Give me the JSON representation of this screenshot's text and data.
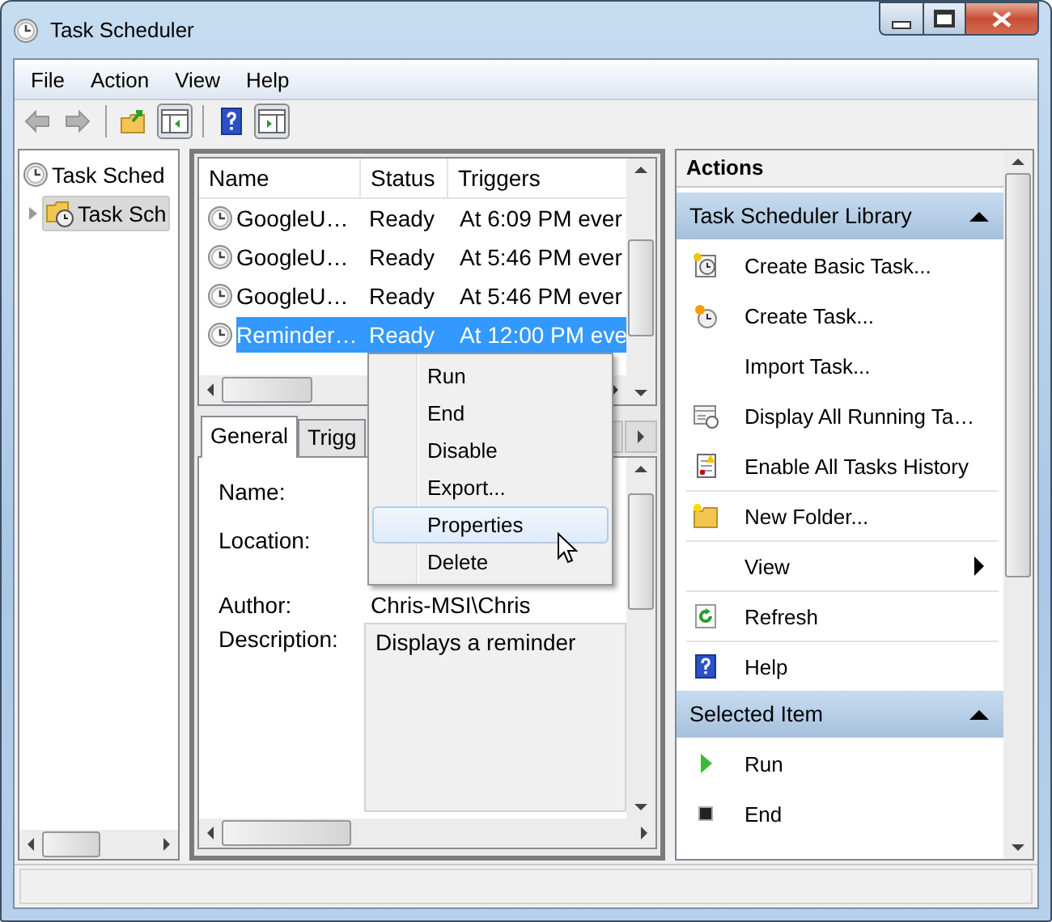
{
  "window": {
    "title": "Task Scheduler"
  },
  "menu": [
    "File",
    "Action",
    "View",
    "Help"
  ],
  "toolbar": [
    [
      {
        "disabled": true,
        "pressed": false
      },
      {
        "disabled": true,
        "pressed": false
      }
    ],
    [
      {
        "disabled": false,
        "pressed": false
      },
      {
        "disabled": false,
        "pressed": true
      }
    ],
    [
      {
        "disabled": false,
        "pressed": false
      },
      {
        "disabled": false,
        "pressed": true
      }
    ]
  ],
  "tree": [
    {
      "label": "Task Sched",
      "selected": false,
      "children": [
        {
          "label": "Task Sch",
          "expanded": false,
          "selected": true
        }
      ]
    }
  ],
  "task_list": {
    "columns": [
      "Name",
      "Status",
      "Triggers"
    ],
    "rows": [
      {
        "name": "GoogleU…",
        "status": "Ready",
        "triggers": "At 6:09 PM ever",
        "selected": false
      },
      {
        "name": "GoogleU…",
        "status": "Ready",
        "triggers": "At 5:46 PM ever",
        "selected": false
      },
      {
        "name": "GoogleU…",
        "status": "Ready",
        "triggers": "At 5:46 PM ever",
        "selected": false
      },
      {
        "name": "Reminder…",
        "status": "Ready",
        "triggers": "At 12:00 PM eve",
        "selected": true
      }
    ]
  },
  "details": {
    "tabs": [
      {
        "label": "General",
        "selected": true
      },
      {
        "label": "Trigg",
        "selected": false
      }
    ],
    "fields": [
      {
        "label": "Name:",
        "kind": "text"
      },
      {
        "label": "Location:",
        "kind": "text"
      },
      {
        "label": "Author:",
        "kind": "text",
        "value": "Chris-MSI\\Chris"
      },
      {
        "label": "Description:",
        "kind": "textarea",
        "value": "Displays a reminder"
      }
    ]
  },
  "actions": {
    "title": "Actions",
    "sections": [
      {
        "title": "Task Scheduler Library",
        "expanded": true,
        "items": [
          {
            "label": "Create Basic Task...",
            "divider": false,
            "submenu": false
          },
          {
            "label": "Create Task...",
            "divider": false,
            "submenu": false
          },
          {
            "label": "Import Task...",
            "divider": false,
            "submenu": false
          },
          {
            "label": "Display All Running Ta…",
            "divider": false,
            "submenu": false
          },
          {
            "label": "Enable All Tasks History",
            "divider": false,
            "submenu": false
          },
          {
            "label": "New Folder...",
            "divider": true,
            "submenu": false
          },
          {
            "label": "View",
            "divider": true,
            "submenu": true
          },
          {
            "label": "Refresh",
            "divider": true,
            "submenu": false
          },
          {
            "label": "Help",
            "divider": true,
            "submenu": false
          }
        ]
      },
      {
        "title": "Selected Item",
        "expanded": true,
        "items": [
          {
            "label": "Run",
            "divider": false,
            "submenu": false
          },
          {
            "label": "End",
            "divider": false,
            "submenu": false
          }
        ]
      }
    ]
  },
  "context_menu": [
    {
      "label": "Run",
      "selected": false
    },
    {
      "label": "End",
      "selected": false
    },
    {
      "label": "Disable",
      "selected": false
    },
    {
      "label": "Export...",
      "selected": false
    },
    {
      "label": "Properties",
      "selected": true
    },
    {
      "label": "Delete",
      "selected": false
    }
  ]
}
